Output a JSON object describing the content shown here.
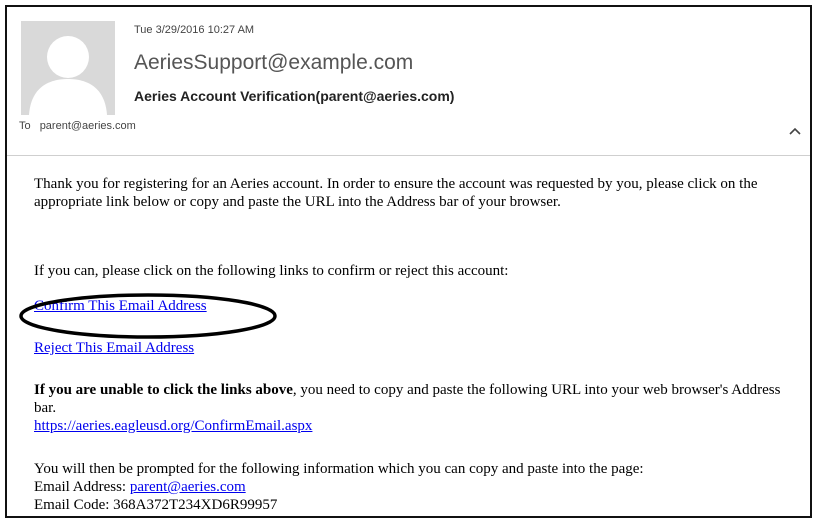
{
  "message": {
    "date": "Tue 3/29/2016 10:27 AM",
    "from": "AeriesSupport@example.com",
    "subject": "Aeries Account Verification(parent@aeries.com)",
    "to_label": "To",
    "to_address": "parent@aeries.com"
  },
  "body": {
    "intro": "Thank you for registering for an Aeries account. In order to ensure the account was requested by you, please click on the appropriate link below or copy and paste the URL into the Address bar of your browser.",
    "links_prompt": "If you can, please click on the following links to confirm or reject this account:",
    "confirm_link": "Confirm This Email Address",
    "reject_link": "Reject This Email Address",
    "unable_bold": "If you are unable to click the links above",
    "unable_rest": ", you need to copy and paste the following URL into your web browser's Address bar.",
    "url": "https://aeries.eagleusd.org/ConfirmEmail.aspx",
    "prompted": "You will then be prompted for the following information which you can copy and paste into the page:",
    "email_label": "Email Address: ",
    "email_value": "parent@aeries.com",
    "code_label": "Email Code: ",
    "code_value": "368A372T234XD6R99957"
  },
  "icons": {
    "avatar": "person-silhouette-icon",
    "collapse": "chevron-up-icon"
  }
}
